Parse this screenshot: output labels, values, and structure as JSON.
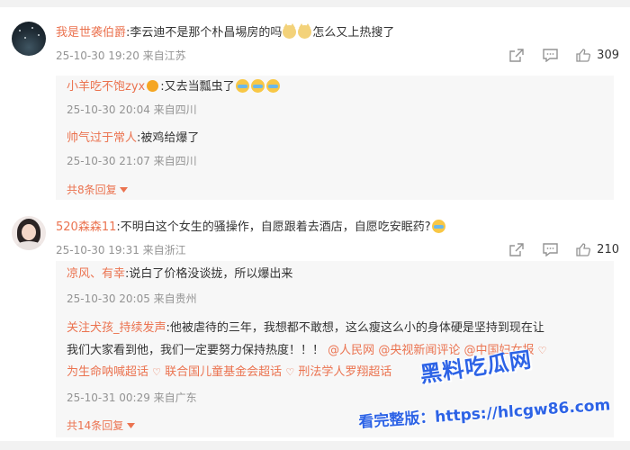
{
  "comments": [
    {
      "user": "我是世袭伯爵",
      "text_prefix": ":李云迪不是那个朴昌埸房的吗",
      "text_suffix": "怎么又上热搜了",
      "meta": "25-10-30 19:20 来自江苏",
      "likes": "309",
      "replies": [
        {
          "user": "小羊吃不饱zyx",
          "text": ":又去当瓢虫了",
          "meta": "25-10-30 20:04 来自四川"
        },
        {
          "user": "帅气过于常人",
          "text": ":被鸡给爆了",
          "meta": "25-10-30 21:07 来自四川"
        }
      ],
      "more": "共8条回复"
    },
    {
      "user": "520森森11",
      "text": ":不明白这个女生的骚操作，自愿跟着去酒店，自愿吃安眠药?",
      "meta": "25-10-30 19:31 来自浙江",
      "likes": "210",
      "replies": [
        {
          "user": "凉风、有幸",
          "text": ":说白了价格没谈拢，所以爆出来",
          "meta": "25-10-30 20:05 来自贵州"
        },
        {
          "user": "关注犬孩_持续发声",
          "line1": ":他被虐待的三年，我想都不敢想，这么瘦这么小的身体硬是坚持到现在让",
          "line2_text": "我们大家看到他，我们一定要努力保持热度！！！",
          "mention1": "@人民网",
          "mention2": "@央视新闻评论",
          "mention3": "@中国妇女报",
          "topic1": "为生命呐喊超话",
          "topic2": "联合国儿童基金会超话",
          "topic3": "刑法学人罗翔超话",
          "meta": "25-10-31 00:29 来自广东"
        }
      ],
      "more": "共14条回复"
    }
  ],
  "watermark": {
    "line1": "黑料吃瓜网",
    "line2": "看完整版：https://hlcgw86.com"
  },
  "colors": {
    "accent": "#eb7350",
    "meta": "#939393",
    "reply_bg": "#f7f7f7",
    "watermark": "#2d63e6"
  },
  "icons": [
    "share-icon",
    "comment-icon",
    "like-icon",
    "chevron-down-icon",
    "heart-icon"
  ]
}
